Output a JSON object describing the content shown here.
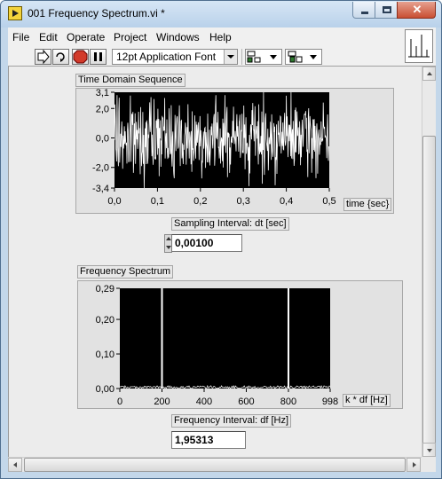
{
  "window": {
    "title": "001 Frequency Spectrum.vi *"
  },
  "menu": [
    "File",
    "Edit",
    "Operate",
    "Project",
    "Windows",
    "Help"
  ],
  "toolbar": {
    "font": "12pt Application Font"
  },
  "time_graph": {
    "label": "Time Domain Sequence",
    "x_axis_label": "time {sec}",
    "x_ticks": [
      "0,0",
      "0,1",
      "0,2",
      "0,3",
      "0,4",
      "0,5"
    ],
    "y_ticks": [
      "3,1",
      "2,0",
      "0,0",
      "-2,0",
      "-3,4"
    ]
  },
  "sampling": {
    "label": "Sampling Interval: dt [sec]",
    "value": "0,00100"
  },
  "freq_graph": {
    "label": "Frequency Spectrum",
    "x_axis_label": "k * df [Hz]",
    "x_ticks": [
      "0",
      "200",
      "400",
      "600",
      "800",
      "998"
    ],
    "y_ticks": [
      "0,29",
      "0,20",
      "0,10",
      "0,00"
    ]
  },
  "freq_interval": {
    "label": "Frequency Interval: df [Hz]",
    "value": "1,95313"
  },
  "chart_data": [
    {
      "type": "line",
      "title": "Time Domain Sequence",
      "xlabel": "time {sec}",
      "ylabel": "",
      "xlim": [
        0,
        0.5
      ],
      "ylim": [
        -3.4,
        3.1
      ],
      "sample_interval": 0.001,
      "series": [
        {
          "x_start": 0,
          "x_step": 0.001,
          "count": 500,
          "peak_to_peak": [
            -3.4,
            3.1
          ]
        }
      ]
    },
    {
      "type": "line",
      "title": "Frequency Spectrum",
      "xlabel": "k * df [Hz]",
      "ylabel": "",
      "xlim": [
        0,
        998
      ],
      "ylim": [
        0,
        0.29
      ],
      "series": [
        {
          "x": [
            0,
            200,
            800,
            998
          ],
          "y": [
            0.003,
            0.29,
            0.29,
            0.003
          ]
        }
      ]
    }
  ]
}
